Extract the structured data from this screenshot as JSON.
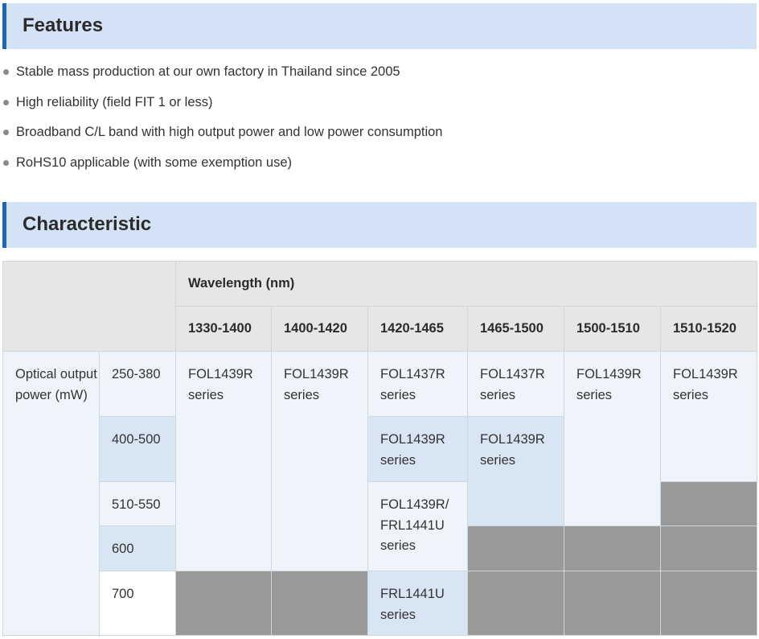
{
  "features": {
    "title": "Features",
    "items": [
      "Stable mass production at our own factory in Thailand since 2005",
      "High reliability (field FIT 1 or less)",
      "Broadband C/L band with high output power and low power consumption",
      "RoHS10 applicable (with some exemption use)"
    ]
  },
  "characteristic": {
    "title": "Characteristic",
    "wavelength_header": "Wavelength (nm)",
    "row_header": "Optical output power (mW)",
    "columns": [
      "1330-1400",
      "1400-1420",
      "1420-1465",
      "1465-1500",
      "1500-1510",
      "1510-1520"
    ],
    "rows": [
      "250-380",
      "400-500",
      "510-550",
      "600",
      "700"
    ],
    "cells": {
      "fol1439r": "FOL1439R series",
      "fol1437r": "FOL1437R series",
      "fol1439r_frl1441u": "FOL1439R/ FRL1441U series",
      "frl1441u": "FRL1441U series"
    }
  },
  "colors": {
    "header_bg": "#d3e3f5",
    "header_accent": "#1a66b8",
    "cell_light": "#eef4fa",
    "cell_blue": "#d8e6f4",
    "cell_unavailable": "#999999"
  }
}
